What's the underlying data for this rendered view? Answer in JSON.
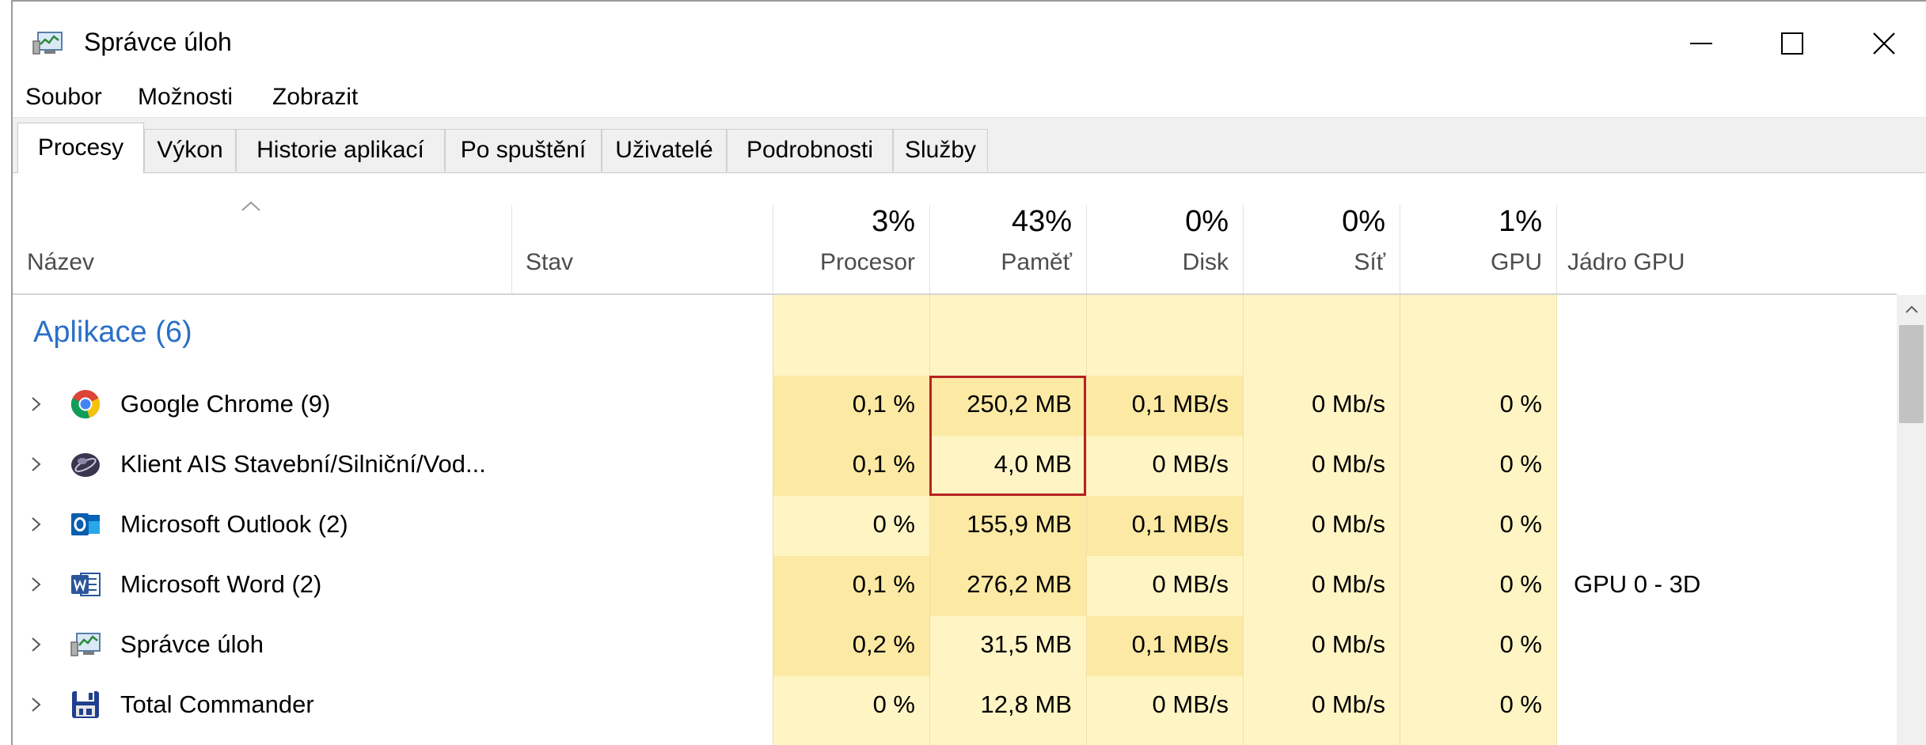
{
  "window": {
    "title": "Správce úloh",
    "icon": "task-manager-icon"
  },
  "menu": {
    "items": [
      "Soubor",
      "Možnosti",
      "Zobrazit"
    ]
  },
  "tabs": [
    "Procesy",
    "Výkon",
    "Historie aplikací",
    "Po spuštění",
    "Uživatelé",
    "Podrobnosti",
    "Služby"
  ],
  "active_tab": "Procesy",
  "columns": {
    "name": "Název",
    "status": "Stav",
    "cpu": {
      "label": "Procesor",
      "total": "3%"
    },
    "memory": {
      "label": "Paměť",
      "total": "43%"
    },
    "disk": {
      "label": "Disk",
      "total": "0%"
    },
    "network": {
      "label": "Síť",
      "total": "0%"
    },
    "gpu": {
      "label": "GPU",
      "total": "1%"
    },
    "gpu_engine": "Jádro GPU"
  },
  "group": {
    "title": "Aplikace (6)"
  },
  "rows": [
    {
      "name": "Google Chrome (9)",
      "icon": "chrome-icon",
      "cpu": "0,1 %",
      "memory": "250,2 MB",
      "disk": "0,1 MB/s",
      "network": "0 Mb/s",
      "gpu": "0 %",
      "gpu_engine": ""
    },
    {
      "name": "Klient AIS Stavební/Silniční/Vod...",
      "icon": "ais-client-icon",
      "cpu": "0,1 %",
      "memory": "4,0 MB",
      "disk": "0 MB/s",
      "network": "0 Mb/s",
      "gpu": "0 %",
      "gpu_engine": ""
    },
    {
      "name": "Microsoft Outlook (2)",
      "icon": "outlook-icon",
      "cpu": "0 %",
      "memory": "155,9 MB",
      "disk": "0,1 MB/s",
      "network": "0 Mb/s",
      "gpu": "0 %",
      "gpu_engine": ""
    },
    {
      "name": "Microsoft Word (2)",
      "icon": "word-icon",
      "cpu": "0,1 %",
      "memory": "276,2 MB",
      "disk": "0 MB/s",
      "network": "0 Mb/s",
      "gpu": "0 %",
      "gpu_engine": "GPU 0 - 3D"
    },
    {
      "name": "Správce úloh",
      "icon": "task-manager-icon",
      "cpu": "0,2 %",
      "memory": "31,5 MB",
      "disk": "0,1 MB/s",
      "network": "0 Mb/s",
      "gpu": "0 %",
      "gpu_engine": ""
    },
    {
      "name": "Total Commander",
      "icon": "total-commander-icon",
      "cpu": "0 %",
      "memory": "12,8 MB",
      "disk": "0 MB/s",
      "network": "0 Mb/s",
      "gpu": "0 %",
      "gpu_engine": ""
    }
  ],
  "colors": {
    "group_title": "#2b6fc8",
    "heat_light": "#fff4c4",
    "heat_medium": "#fce9a3",
    "highlight_border": "#b52222"
  }
}
